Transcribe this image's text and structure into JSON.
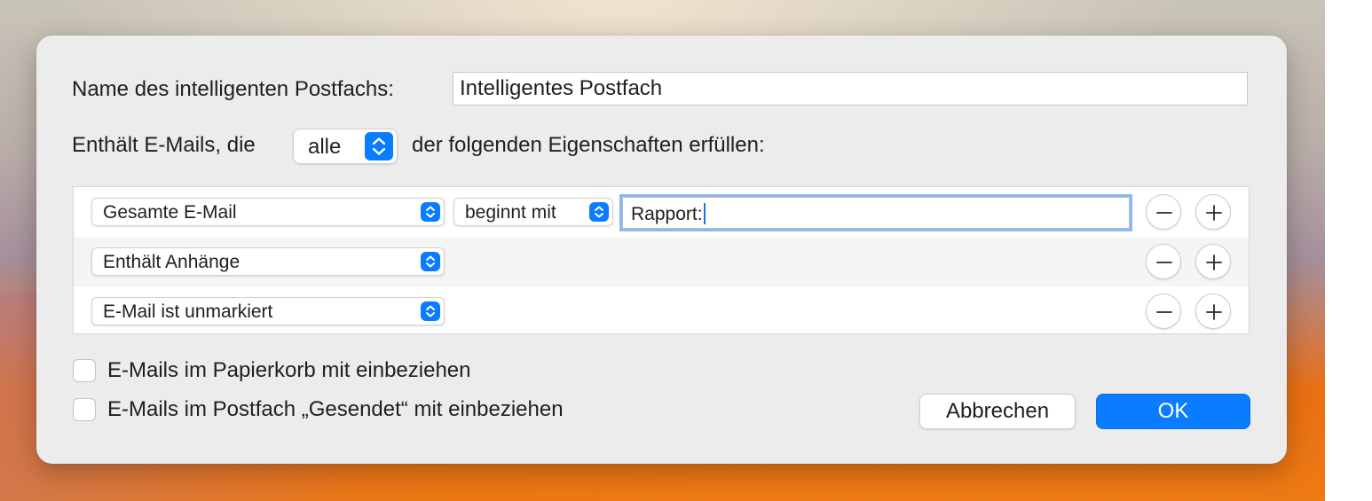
{
  "dialog": {
    "name_label": "Name des intelligenten Postfachs:",
    "name_value": "Intelligentes Postfach",
    "contains_prefix": "Enthält E-Mails, die",
    "match_mode": "alle",
    "contains_suffix": "der folgenden Eigenschaften erfüllen:"
  },
  "rules": [
    {
      "field": "Gesamte E-Mail",
      "operator": "beginnt mit",
      "value": "Rapport:"
    },
    {
      "field": "Enthält Anhänge"
    },
    {
      "field": "E-Mail ist unmarkiert"
    }
  ],
  "options": {
    "trash_label": "E-Mails im Papierkorb mit einbeziehen",
    "trash_checked": false,
    "sent_label": "E-Mails im Postfach „Gesendet“ mit einbeziehen",
    "sent_checked": false
  },
  "buttons": {
    "cancel": "Abbrechen",
    "ok": "OK"
  },
  "colors": {
    "accent": "#0a7cff",
    "dialog_bg": "#ececec"
  },
  "icons": {
    "remove": "minus-icon",
    "add": "plus-icon",
    "popup": "up-down-chevron-icon"
  }
}
